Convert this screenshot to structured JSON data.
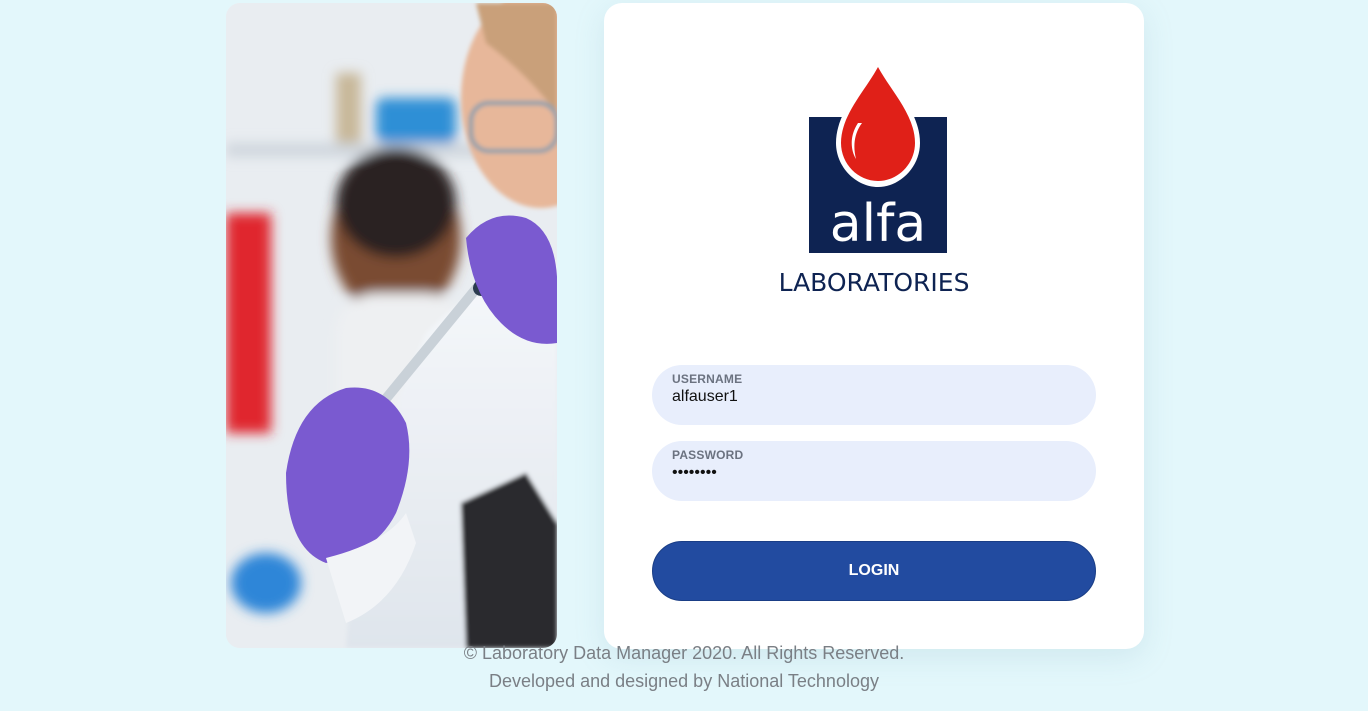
{
  "brand": {
    "logo_word": "alfa",
    "logo_subtitle": "LABORATORIES",
    "colors": {
      "navy": "#0e2352",
      "drop_red": "#e02018"
    }
  },
  "form": {
    "username": {
      "label": "USERNAME",
      "value": "alfauser1"
    },
    "password": {
      "label": "PASSWORD",
      "value": "••••••••"
    },
    "login_label": "LOGIN",
    "button_color": "#224ba0"
  },
  "footer": {
    "copyright": "© Laboratory Data Manager 2020. All Rights Reserved.",
    "credit": "Developed and designed by National Technology"
  }
}
